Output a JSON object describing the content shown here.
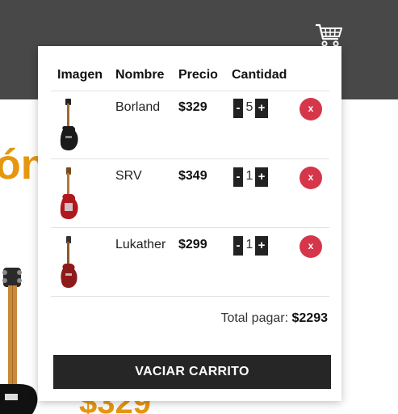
{
  "header": {
    "cart_icon": "shopping-cart-icon",
    "background": "#484848"
  },
  "background_content": {
    "heading_fragment": "ón",
    "price_fragment": "$329",
    "accent": "#e6970f"
  },
  "cart": {
    "columns": {
      "image": "Imagen",
      "name": "Nombre",
      "price": "Precio",
      "quantity": "Cantidad"
    },
    "items": [
      {
        "name": "Borland",
        "price": "$329",
        "quantity": "5",
        "minus": "-",
        "plus": "+",
        "remove": "x",
        "guitar_color": "#1a1a1a"
      },
      {
        "name": "SRV",
        "price": "$349",
        "quantity": "1",
        "minus": "-",
        "plus": "+",
        "remove": "x",
        "guitar_color": "#b01820"
      },
      {
        "name": "Lukather",
        "price": "$299",
        "quantity": "1",
        "minus": "-",
        "plus": "+",
        "remove": "x",
        "guitar_color": "#8e1a1a"
      }
    ],
    "total_label": "Total pagar:",
    "total_value": "$2293",
    "empty_button": "VACIAR CARRITO",
    "remove_color": "#d6364a"
  }
}
